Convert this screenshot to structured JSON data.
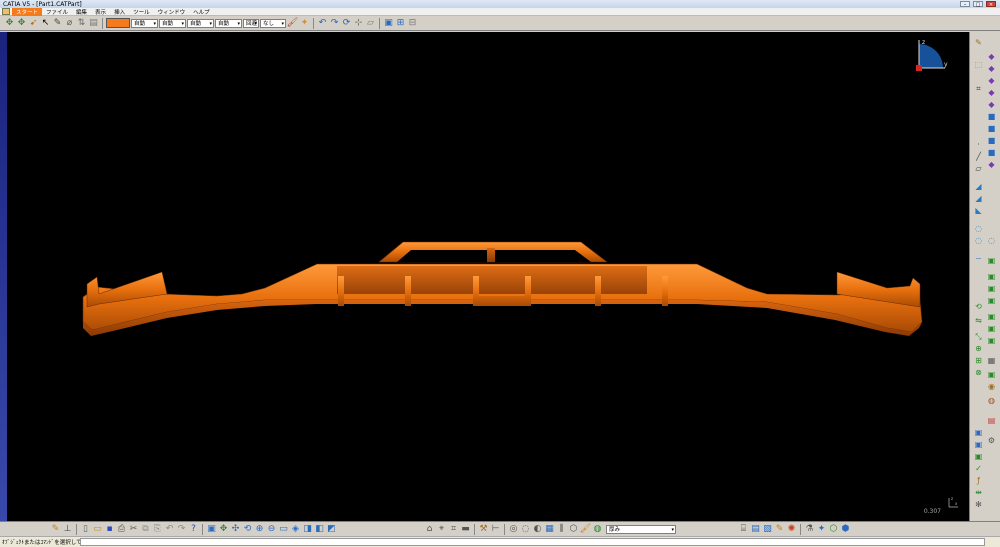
{
  "window": {
    "title": "CATIA V5 - [Part1.CATPart]",
    "controls": [
      "–",
      "□",
      "×"
    ]
  },
  "menubar": {
    "items": [
      "スタート",
      "ファイル",
      "編集",
      "表示",
      "挿入",
      "ツール",
      "ウィンドウ",
      "ヘルプ"
    ],
    "active_index": 0
  },
  "toolbar": {
    "color_swatch": "#f47a1c",
    "dropdowns": [
      "自動",
      "自動",
      "自動",
      "自動",
      "回避",
      "なし"
    ]
  },
  "viewport": {
    "background": "#000000",
    "part_color": "#f47a1c",
    "scale_value": "0.307",
    "axis_labels": {
      "z": "z",
      "y": "y",
      "x": "x"
    }
  },
  "bottom_toolbar": {
    "material_dropdown": "厚み"
  },
  "statusbar": {
    "prompt": "ｵﾌﾞｼﾞｪｸﾄまたはｺﾏﾝﾄﾞを選択してください"
  }
}
